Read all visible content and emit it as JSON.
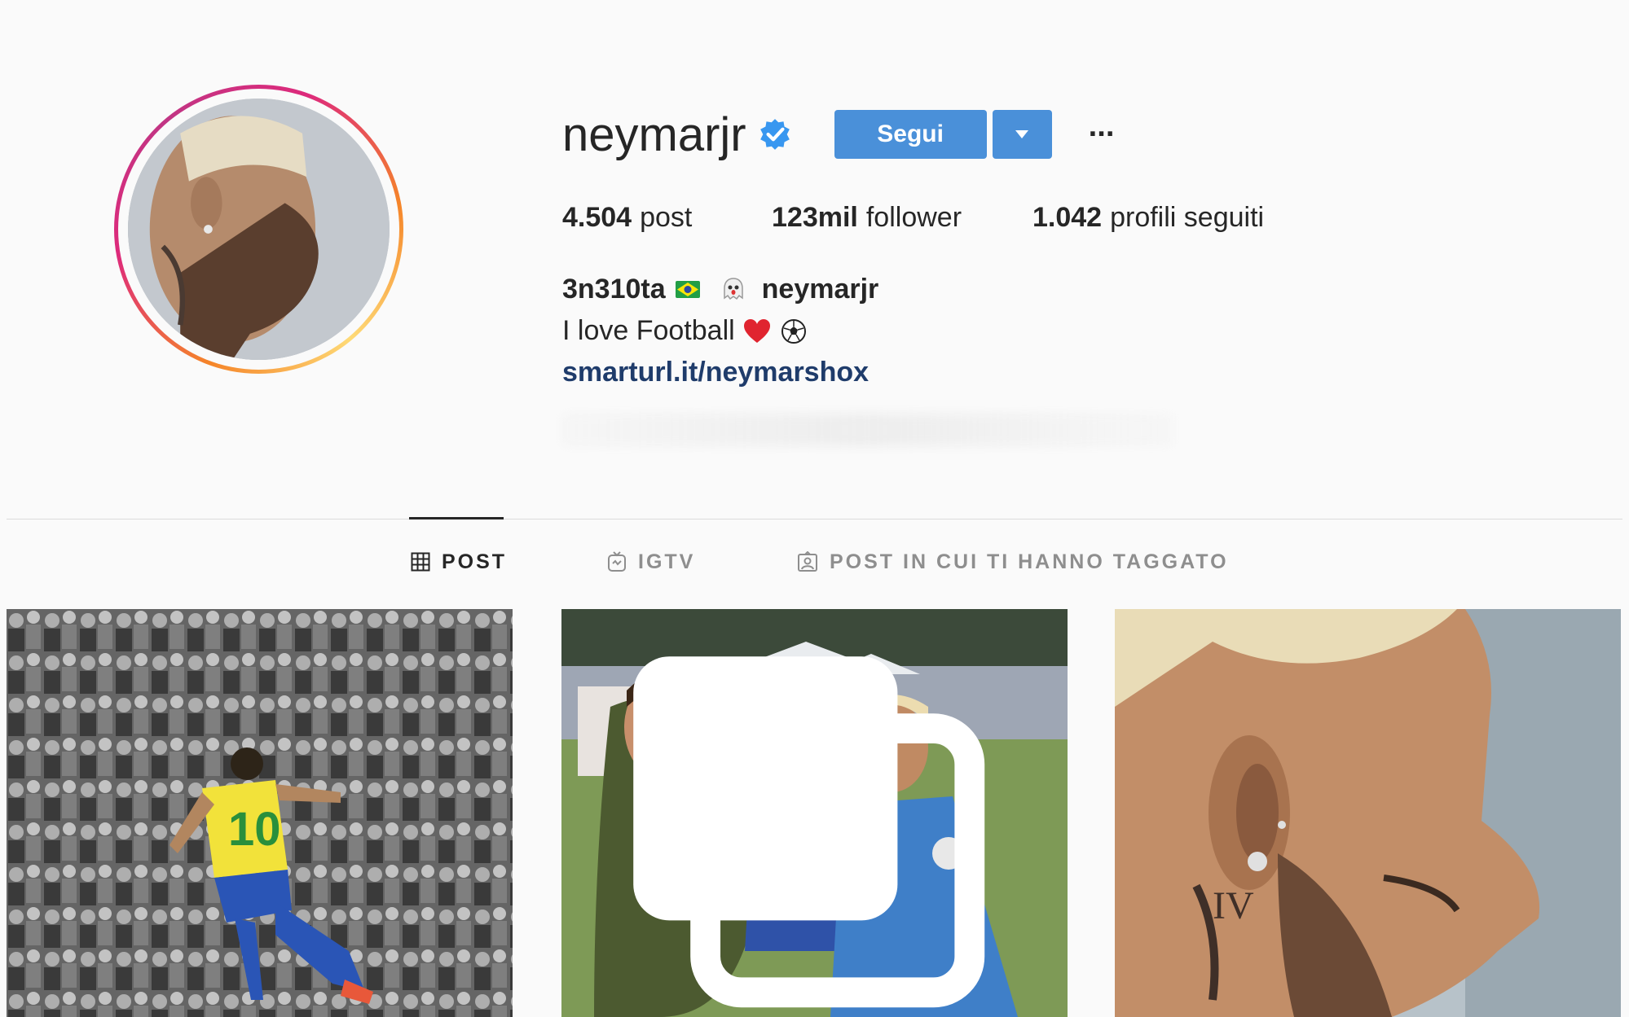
{
  "profile": {
    "username": "neymarjr",
    "follow_label": "Segui",
    "more_label": "···",
    "stats": {
      "posts_count": "4.504",
      "posts_label": "post",
      "followers_count": "123mil",
      "followers_label": "follower",
      "following_count": "1.042",
      "following_label": "profili seguiti"
    },
    "bio": {
      "snapchat_handle": "3n310ta",
      "snapchat_name": "neymarjr",
      "text": "I love Football",
      "link": "smarturl.it/neymarshox"
    }
  },
  "tabs": [
    {
      "label": "POST",
      "icon": "grid-icon",
      "active": true
    },
    {
      "label": "IGTV",
      "icon": "igtv-icon",
      "active": false
    },
    {
      "label": "POST IN CUI TI HANNO TAGGATO",
      "icon": "tagged-icon",
      "active": false
    }
  ],
  "colors": {
    "accent": "#4a90d9",
    "verified": "#3897f0",
    "link": "#1f3c6b",
    "text": "#262626",
    "muted": "#8e8e8e"
  }
}
